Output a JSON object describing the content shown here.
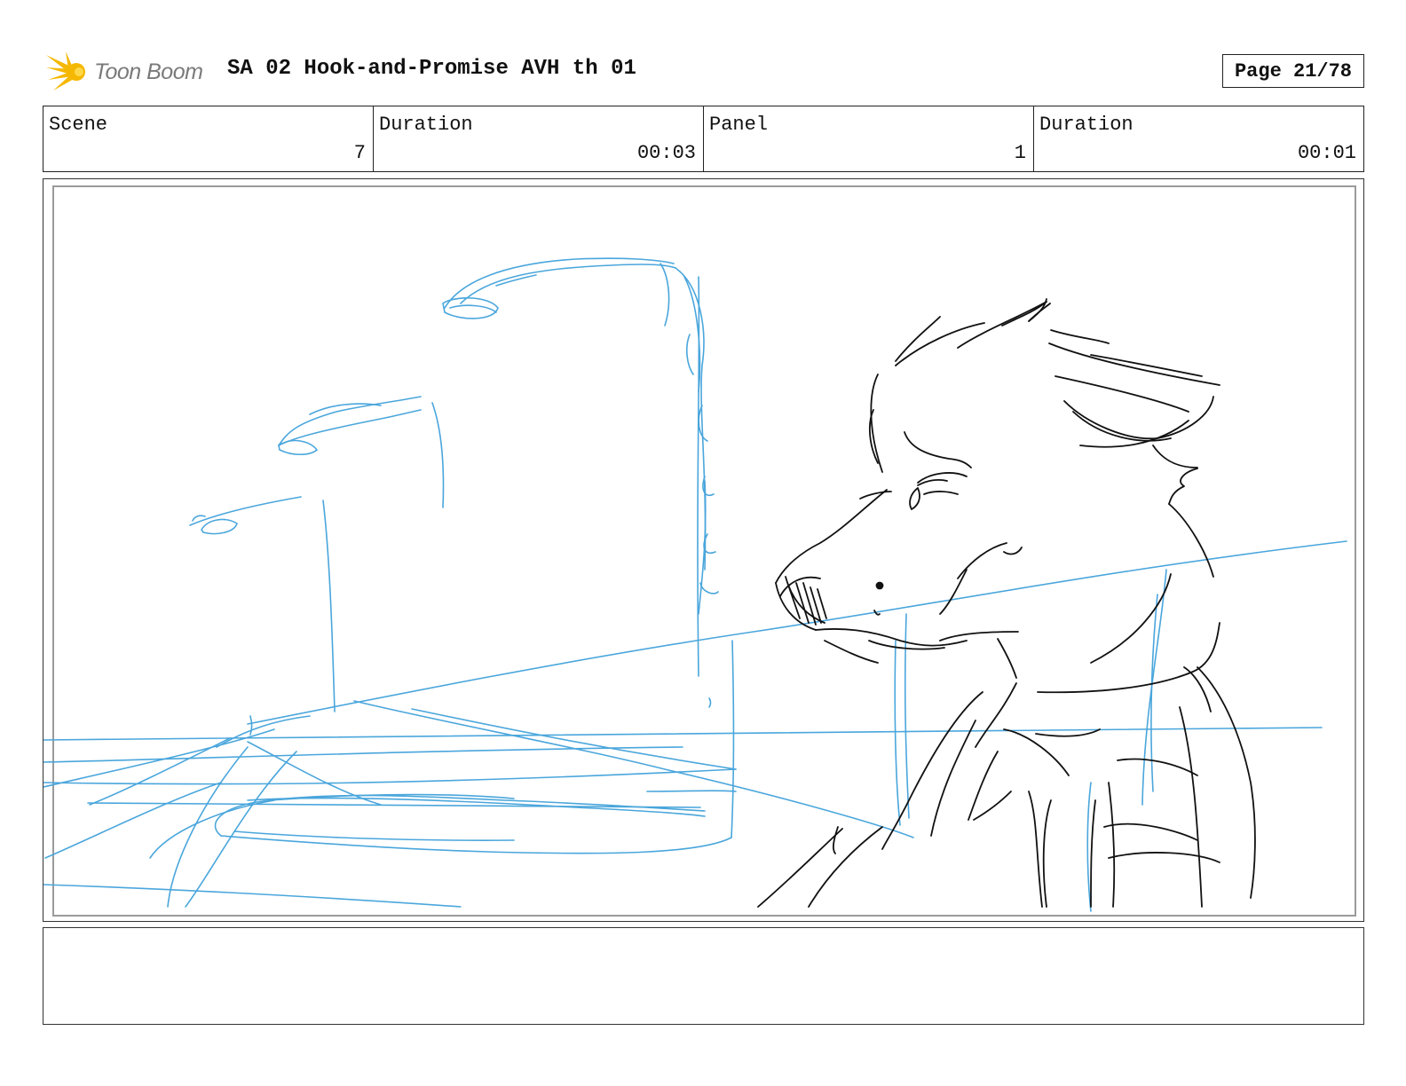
{
  "header": {
    "logo_text": "Toon Boom",
    "title": "SA 02 Hook-and-Promise AVH th 01",
    "page": "Page 21/78"
  },
  "info": {
    "scene_label": "Scene",
    "scene_value": "7",
    "scene_duration_label": "Duration",
    "scene_duration_value": "00:03",
    "panel_label": "Panel",
    "panel_value": "1",
    "panel_duration_label": "Duration",
    "panel_duration_value": "00:01"
  },
  "colors": {
    "sketch_blue": "#4aa6dc",
    "sketch_black": "#111111",
    "logo_yellow": "#f5b800"
  }
}
